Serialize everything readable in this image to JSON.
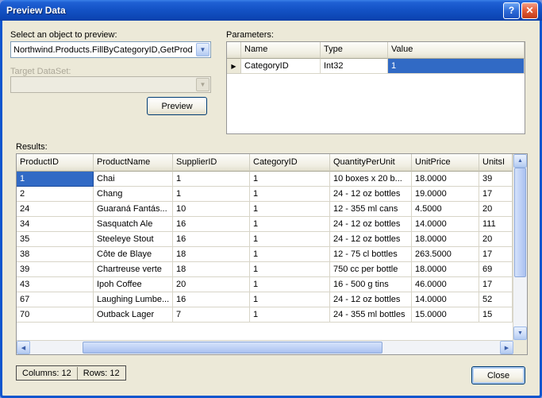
{
  "titlebar": {
    "title": "Preview Data",
    "help_glyph": "?",
    "close_glyph": "✕"
  },
  "object_picker": {
    "label": "Select an object to preview:",
    "value": "Northwind.Products.FillByCategoryID,GetProd"
  },
  "target_dataset": {
    "label": "Target DataSet:",
    "value": ""
  },
  "buttons": {
    "preview": "Preview",
    "close": "Close"
  },
  "parameters": {
    "label": "Parameters:",
    "columns": [
      "Name",
      "Type",
      "Value"
    ],
    "rows": [
      {
        "name": "CategoryID",
        "type": "Int32",
        "value": "1"
      }
    ],
    "selected": {
      "row": 0,
      "column": "value"
    }
  },
  "results": {
    "label": "Results:",
    "columns": [
      "ProductID",
      "ProductName",
      "SupplierID",
      "CategoryID",
      "QuantityPerUnit",
      "UnitPrice",
      "UnitsI"
    ],
    "rows": [
      [
        "1",
        "Chai",
        "1",
        "1",
        "10 boxes x 20 b...",
        "18.0000",
        "39"
      ],
      [
        "2",
        "Chang",
        "1",
        "1",
        "24 - 12 oz bottles",
        "19.0000",
        "17"
      ],
      [
        "24",
        "Guaraná Fantás...",
        "10",
        "1",
        "12 - 355 ml cans",
        "4.5000",
        "20"
      ],
      [
        "34",
        "Sasquatch Ale",
        "16",
        "1",
        "24 - 12 oz bottles",
        "14.0000",
        "111"
      ],
      [
        "35",
        "Steeleye Stout",
        "16",
        "1",
        "24 - 12 oz bottles",
        "18.0000",
        "20"
      ],
      [
        "38",
        "Côte de Blaye",
        "18",
        "1",
        "12 - 75 cl bottles",
        "263.5000",
        "17"
      ],
      [
        "39",
        "Chartreuse verte",
        "18",
        "1",
        "750 cc per bottle",
        "18.0000",
        "69"
      ],
      [
        "43",
        "Ipoh Coffee",
        "20",
        "1",
        "16 - 500 g tins",
        "46.0000",
        "17"
      ],
      [
        "67",
        "Laughing Lumbe...",
        "16",
        "1",
        "24 - 12 oz bottles",
        "14.0000",
        "52"
      ],
      [
        "70",
        "Outback Lager",
        "7",
        "1",
        "24 - 355 ml bottles",
        "15.0000",
        "15"
      ]
    ],
    "selected_cell": {
      "row": 0,
      "col": 0
    }
  },
  "status": {
    "columns": "Columns: 12",
    "rows": "Rows: 12"
  }
}
